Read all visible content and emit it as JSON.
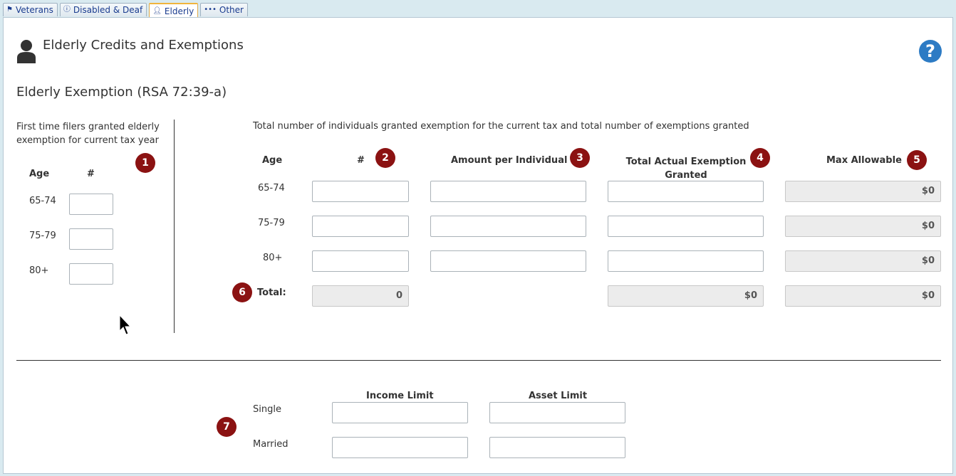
{
  "tabs": [
    {
      "label": "Veterans",
      "icon": "flag-icon"
    },
    {
      "label": "Disabled & Deaf",
      "icon": "info-icon"
    },
    {
      "label": "Elderly",
      "icon": "user-icon"
    },
    {
      "label": "Other",
      "icon": "ellipsis-icon"
    }
  ],
  "active_tab": "Elderly",
  "page": {
    "title": "Elderly Credits and Exemptions",
    "help_label": "?"
  },
  "section": {
    "title": "Elderly Exemption (RSA 72:39-a)"
  },
  "first_time": {
    "description": "First time filers granted elderly exemption for current tax year",
    "age_header": "Age",
    "count_header": "#",
    "rows": [
      "65-74",
      "75-79",
      "80+"
    ]
  },
  "totals": {
    "description": "Total number of individuals granted exemption for the current tax and total number of exemptions granted",
    "headers": {
      "age": "Age",
      "count": "#",
      "amount": "Amount per Individual",
      "total_actual": "Total Actual Exemption Granted",
      "max_allowable": "Max Allowable"
    },
    "rows": [
      {
        "age": "65-74",
        "max": "$0"
      },
      {
        "age": "75-79",
        "max": "$0"
      },
      {
        "age": "80+",
        "max": "$0"
      }
    ],
    "total_label": "Total:",
    "total_count": "0",
    "total_actual": "$0",
    "total_max": "$0"
  },
  "limits": {
    "income_header": "Income Limit",
    "asset_header": "Asset Limit",
    "single_label": "Single",
    "married_label": "Married"
  },
  "badges": [
    "1",
    "2",
    "3",
    "4",
    "5",
    "6",
    "7"
  ],
  "colors": {
    "badge": "#8b1212",
    "help": "#2d7bc4",
    "tab_text": "#1a3c8f"
  }
}
